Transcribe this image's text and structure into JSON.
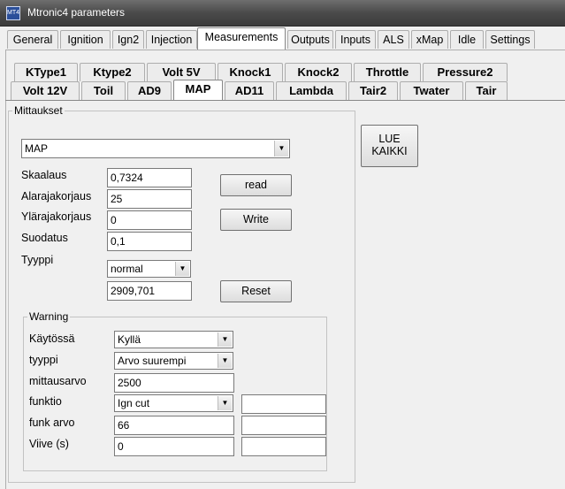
{
  "window": {
    "title": "Mtronic4 parameters",
    "icon": "app-icon",
    "icon_text": "MT4"
  },
  "tabs_main": [
    "General",
    "Ignition",
    "Ign2",
    "Injection",
    "Measurements",
    "Outputs",
    "Inputs",
    "ALS",
    "xMap",
    "Idle",
    "Settings"
  ],
  "tabs_main_selected": "Measurements",
  "tabs_sub_row1": [
    "KType1",
    "Ktype2",
    "Volt 5V",
    "Knock1",
    "Knock2",
    "Throttle",
    "Pressure2"
  ],
  "tabs_sub_row2": [
    "Volt 12V",
    "Toil",
    "AD9",
    "MAP",
    "AD11",
    "Lambda",
    "Tair2",
    "Twater",
    "Tair"
  ],
  "tabs_sub_selected": "MAP",
  "mittaukset": {
    "legend": "Mittaukset",
    "sensor_select": "MAP",
    "skaalaus_label": "Skaalaus",
    "skaalaus_value": "0,7324",
    "alarajakorjaus_label": "Alarajakorjaus",
    "alarajakorjaus_value": "25",
    "ylarajakorjaus_label": "Ylärajakorjaus",
    "ylarajakorjaus_value": "0",
    "suodatus_label": "Suodatus",
    "suodatus_value": "0,1",
    "tyyppi_label": "Tyyppi",
    "tyyppi_value": "normal",
    "current_value": "2909,701",
    "read_label": "read",
    "write_label": "Write",
    "reset_label": "Reset"
  },
  "lue_kaikki": {
    "line1": "LUE",
    "line2": "KAIKKI"
  },
  "warning": {
    "legend": "Warning",
    "kaytossa_label": "Käytössä",
    "kaytossa_value": "Kyllä",
    "tyyppi_label": "tyyppi",
    "tyyppi_value": "Arvo suurempi",
    "mittausarvo_label": "mittausarvo",
    "mittausarvo_value": "2500",
    "funktio_label": "funktio",
    "funktio_value": "Ign cut",
    "funk_arvo_label": "funk arvo",
    "funk_arvo_value": "66",
    "viive_label": "Viive (s)",
    "viive_value": "0",
    "extra1_value": "",
    "extra2_value": "",
    "extra3_value": ""
  },
  "icons": {
    "dropdown": "chevron-down-icon"
  }
}
